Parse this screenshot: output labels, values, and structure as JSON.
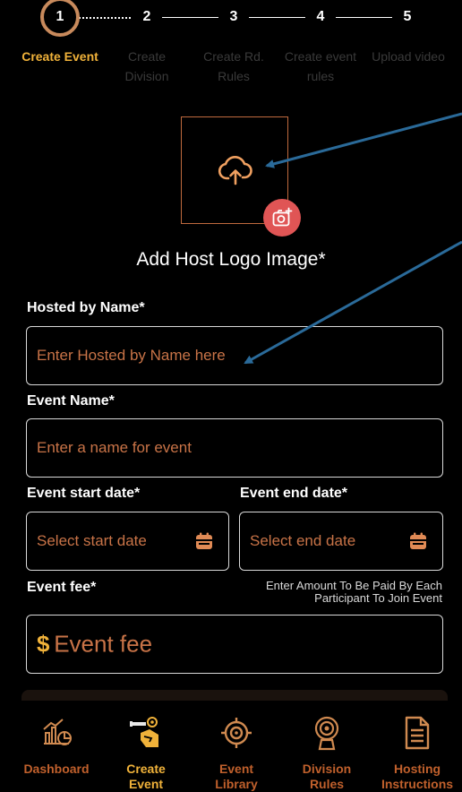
{
  "stepper": {
    "steps": [
      {
        "number": "1",
        "label": "Create Event",
        "active": true
      },
      {
        "number": "2",
        "label": "Create Division",
        "active": false
      },
      {
        "number": "3",
        "label": "Create Rd. Rules",
        "active": false
      },
      {
        "number": "4",
        "label": "Create event rules",
        "active": false
      },
      {
        "number": "5",
        "label": "Upload video",
        "active": false
      }
    ]
  },
  "logo_upload": {
    "icon": "cloud-upload-icon",
    "badge_icon": "camera-add-icon",
    "title": "Add Host Logo Image*"
  },
  "form": {
    "hosted_by": {
      "label": "Hosted by Name*",
      "placeholder": "Enter Hosted by Name here"
    },
    "event_name": {
      "label": "Event Name*",
      "placeholder": "Enter a name for event"
    },
    "start_date": {
      "label": "Event start date*",
      "placeholder": "Select start date"
    },
    "end_date": {
      "label": "Event end date*",
      "placeholder": "Select end date"
    },
    "event_fee": {
      "label": "Event fee*",
      "note_line1": "Enter Amount To Be Paid By Each",
      "note_line2": "Participant To Join Event",
      "currency": "$",
      "placeholder": "Event fee"
    }
  },
  "bottom_nav": {
    "items": [
      {
        "label_line1": "Dashboard",
        "label_line2": "",
        "icon": "dashboard-icon",
        "active": false
      },
      {
        "label_line1": "Create",
        "label_line2": "Event",
        "icon": "create-event-icon",
        "active": true
      },
      {
        "label_line1": "Event",
        "label_line2": "Library",
        "icon": "target-icon",
        "active": false
      },
      {
        "label_line1": "Division",
        "label_line2": "Rules",
        "icon": "division-rules-icon",
        "active": false
      },
      {
        "label_line1": "Hosting",
        "label_line2": "Instructions",
        "icon": "document-icon",
        "active": false
      }
    ]
  },
  "colors": {
    "accent_gold": "#f0b23a",
    "accent_copper": "#c87347",
    "badge_red": "#e05555",
    "annotation_arrow": "#2a6a99"
  }
}
